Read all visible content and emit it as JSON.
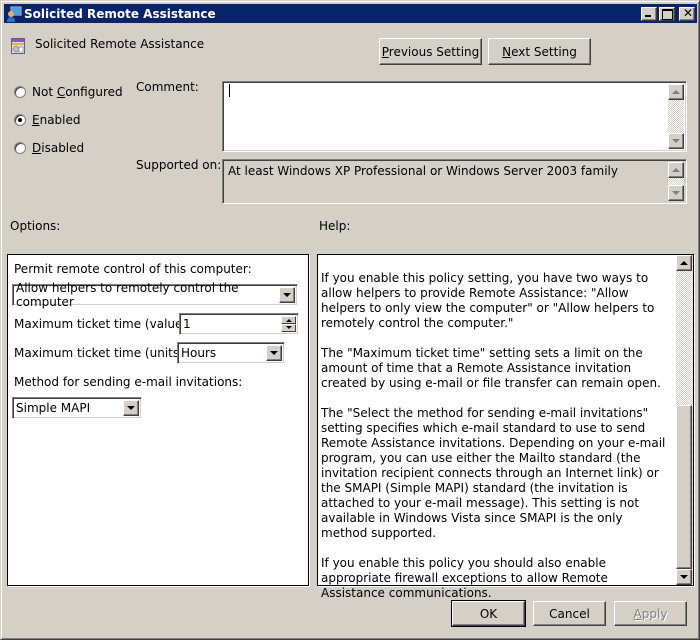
{
  "window": {
    "title": "Solicited Remote Assistance",
    "controls": {
      "minimize": "minimize",
      "maximize": "maximize",
      "close": "close"
    }
  },
  "header": {
    "policy_name": "Solicited Remote Assistance",
    "previous_button": {
      "pre": "",
      "accel": "P",
      "post": "revious Setting"
    },
    "next_button": {
      "pre": "",
      "accel": "N",
      "post": "ext Setting"
    }
  },
  "state": {
    "options": [
      {
        "pre": "Not ",
        "accel": "C",
        "post": "onfigured",
        "checked": false
      },
      {
        "pre": "",
        "accel": "E",
        "post": "nabled",
        "checked": true
      },
      {
        "pre": "",
        "accel": "D",
        "post": "isabled",
        "checked": false
      }
    ]
  },
  "comment": {
    "label": "Comment:",
    "value": ""
  },
  "supported": {
    "label": "Supported on:",
    "value": "At least Windows XP Professional or Windows Server 2003 family"
  },
  "options_panel": {
    "heading": "Options:",
    "permit_label": "Permit remote control of this computer:",
    "permit_value": "Allow helpers to remotely control the computer",
    "ticket_value_label": "Maximum ticket time (value):",
    "ticket_value": "1",
    "ticket_units_label": "Maximum ticket time (units):",
    "ticket_units": "Hours",
    "email_method_label": "Method for sending e-mail invitations:",
    "email_method": "Simple MAPI"
  },
  "help_panel": {
    "heading": "Help:",
    "paragraphs": [
      "If you enable this policy setting, you have two ways to allow helpers to provide Remote Assistance: \"Allow helpers to only view the computer\" or \"Allow helpers to remotely control the computer.\"",
      "The \"Maximum ticket time\" setting sets a limit on the amount of time that a Remote Assistance invitation created by using e-mail or file transfer can remain open.",
      "The \"Select the method for sending e-mail invitations\" setting specifies which e-mail standard to use to send Remote Assistance invitations. Depending on your e-mail program, you can use either the Mailto standard (the invitation recipient connects through an Internet link) or the SMAPI (Simple MAPI) standard (the invitation is attached to your e-mail message). This setting is not available in Windows Vista since SMAPI is the only method supported.",
      "If you enable this policy you should also enable appropriate firewall exceptions to allow Remote Assistance communications."
    ],
    "scroll_position": 0.62
  },
  "footer": {
    "ok": "OK",
    "cancel": "Cancel",
    "apply": {
      "pre": "",
      "accel": "A",
      "post": "pply",
      "disabled": true
    }
  },
  "colors": {
    "titlebar": "#0a246a",
    "face": "#d4d0c8"
  }
}
